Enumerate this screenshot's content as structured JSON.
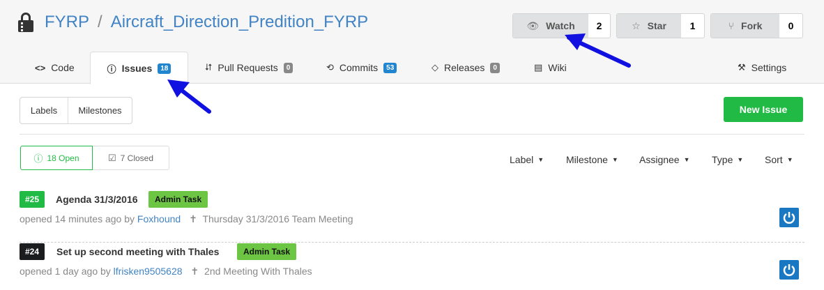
{
  "repo": {
    "owner": "FYRP",
    "separator": "/",
    "name": "Aircraft_Direction_Predition_FYRP"
  },
  "actions": {
    "watch": {
      "label": "Watch",
      "count": "2"
    },
    "star": {
      "label": "Star",
      "count": "1"
    },
    "fork": {
      "label": "Fork",
      "count": "0"
    }
  },
  "tabs": [
    {
      "label": "Code",
      "icon": "code-icon"
    },
    {
      "label": "Issues",
      "badge": "18",
      "icon": "issue-opened-icon"
    },
    {
      "label": "Pull Requests",
      "badge": "0",
      "icon": "git-pull-request-icon"
    },
    {
      "label": "Commits",
      "badge": "53",
      "icon": "history-icon"
    },
    {
      "label": "Releases",
      "badge": "0",
      "icon": "tag-icon"
    },
    {
      "label": "Wiki",
      "icon": "book-icon"
    },
    {
      "label": "Settings",
      "icon": "tools-icon"
    }
  ],
  "toolbar": {
    "labels": "Labels",
    "milestones": "Milestones",
    "new_issue": "New Issue"
  },
  "state": {
    "open": "18 Open",
    "closed": "7 Closed"
  },
  "filters": [
    "Label",
    "Milestone",
    "Assignee",
    "Type",
    "Sort"
  ],
  "issues": [
    {
      "number": "#25",
      "number_color": "#21ba45",
      "title": "Agenda 31/3/2016",
      "label": "Admin Task",
      "opened": "opened 14 minutes ago by",
      "user": "Foxhound",
      "milestone": "Thursday 31/3/2016 Team Meeting"
    },
    {
      "number": "#24",
      "number_color": "#1b1c1d",
      "title": "Set up second meeting with Thales",
      "label": "Admin Task",
      "opened": "opened 1 day ago by",
      "user": "lfrisken9505628",
      "milestone": "2nd Meeting With Thales"
    }
  ],
  "colors": {
    "link": "#4183c4",
    "green": "#21ba45",
    "blue_badge": "#2185d0",
    "label_green": "#6cc644",
    "arrow": "#1010e0"
  }
}
